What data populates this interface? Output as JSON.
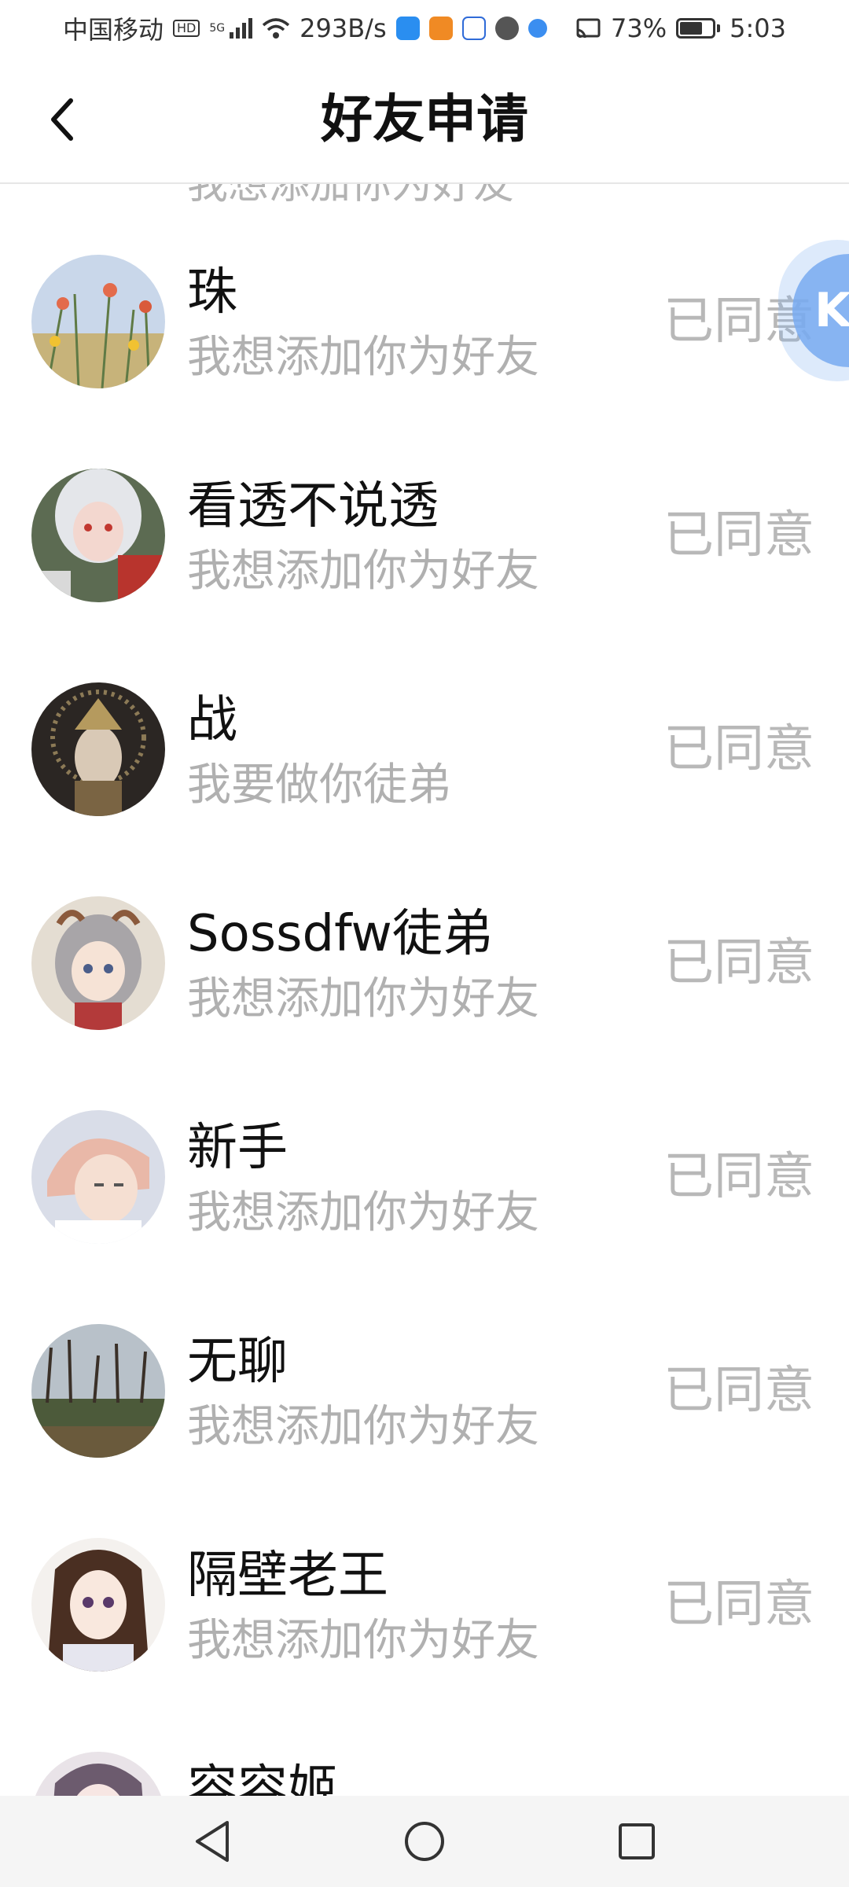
{
  "status_bar": {
    "carrier": "中国移动",
    "hd": "HD",
    "network": "5G",
    "speed": "293B/s",
    "battery": "73%",
    "time": "5:03",
    "icons": [
      "weather-icon",
      "video-icon",
      "baidu-icon",
      "wechat-icon",
      "browser-icon",
      "cast-icon"
    ]
  },
  "header": {
    "title": "好友申请",
    "back_icon": "back-arrow-icon"
  },
  "list": {
    "partial_top_text": "我想添加你为好友",
    "items": [
      {
        "name": "珠",
        "message": "我想添加你为好友",
        "status": "已同意"
      },
      {
        "name": "看透不说透",
        "message": "我想添加你为好友",
        "status": "已同意"
      },
      {
        "name": "战",
        "message": "我要做你徒弟",
        "status": "已同意"
      },
      {
        "name": "Sossdfw徒弟",
        "message": "我想添加你为好友",
        "status": "已同意"
      },
      {
        "name": "新手",
        "message": "我想添加你为好友",
        "status": "已同意"
      },
      {
        "name": "无聊",
        "message": "我想添加你为好友",
        "status": "已同意"
      },
      {
        "name": "隔壁老王",
        "message": "我想添加你为好友",
        "status": "已同意"
      },
      {
        "name": "容容姬",
        "message": "",
        "status": ""
      }
    ]
  },
  "floating_button": {
    "label": "K"
  },
  "nav_bar": {
    "icons": [
      "back-triangle-icon",
      "home-circle-icon",
      "recents-square-icon"
    ]
  }
}
